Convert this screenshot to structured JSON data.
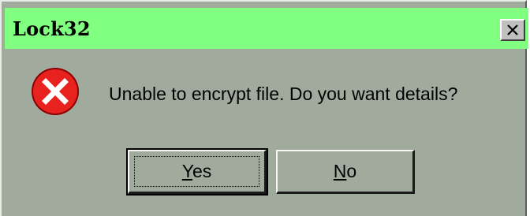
{
  "window": {
    "title": "Lock32",
    "close_icon": "close-x-icon"
  },
  "dialog": {
    "icon": "error-icon",
    "message": "Unable to encrypt file.  Do you want details?"
  },
  "buttons": {
    "yes": {
      "accel": "Y",
      "rest": "es"
    },
    "no": {
      "accel": "N",
      "rest": "o"
    }
  },
  "colors": {
    "titlebar": "#80ff80",
    "dialog_face": "#a1ab9d",
    "error_red": "#e8231f"
  }
}
